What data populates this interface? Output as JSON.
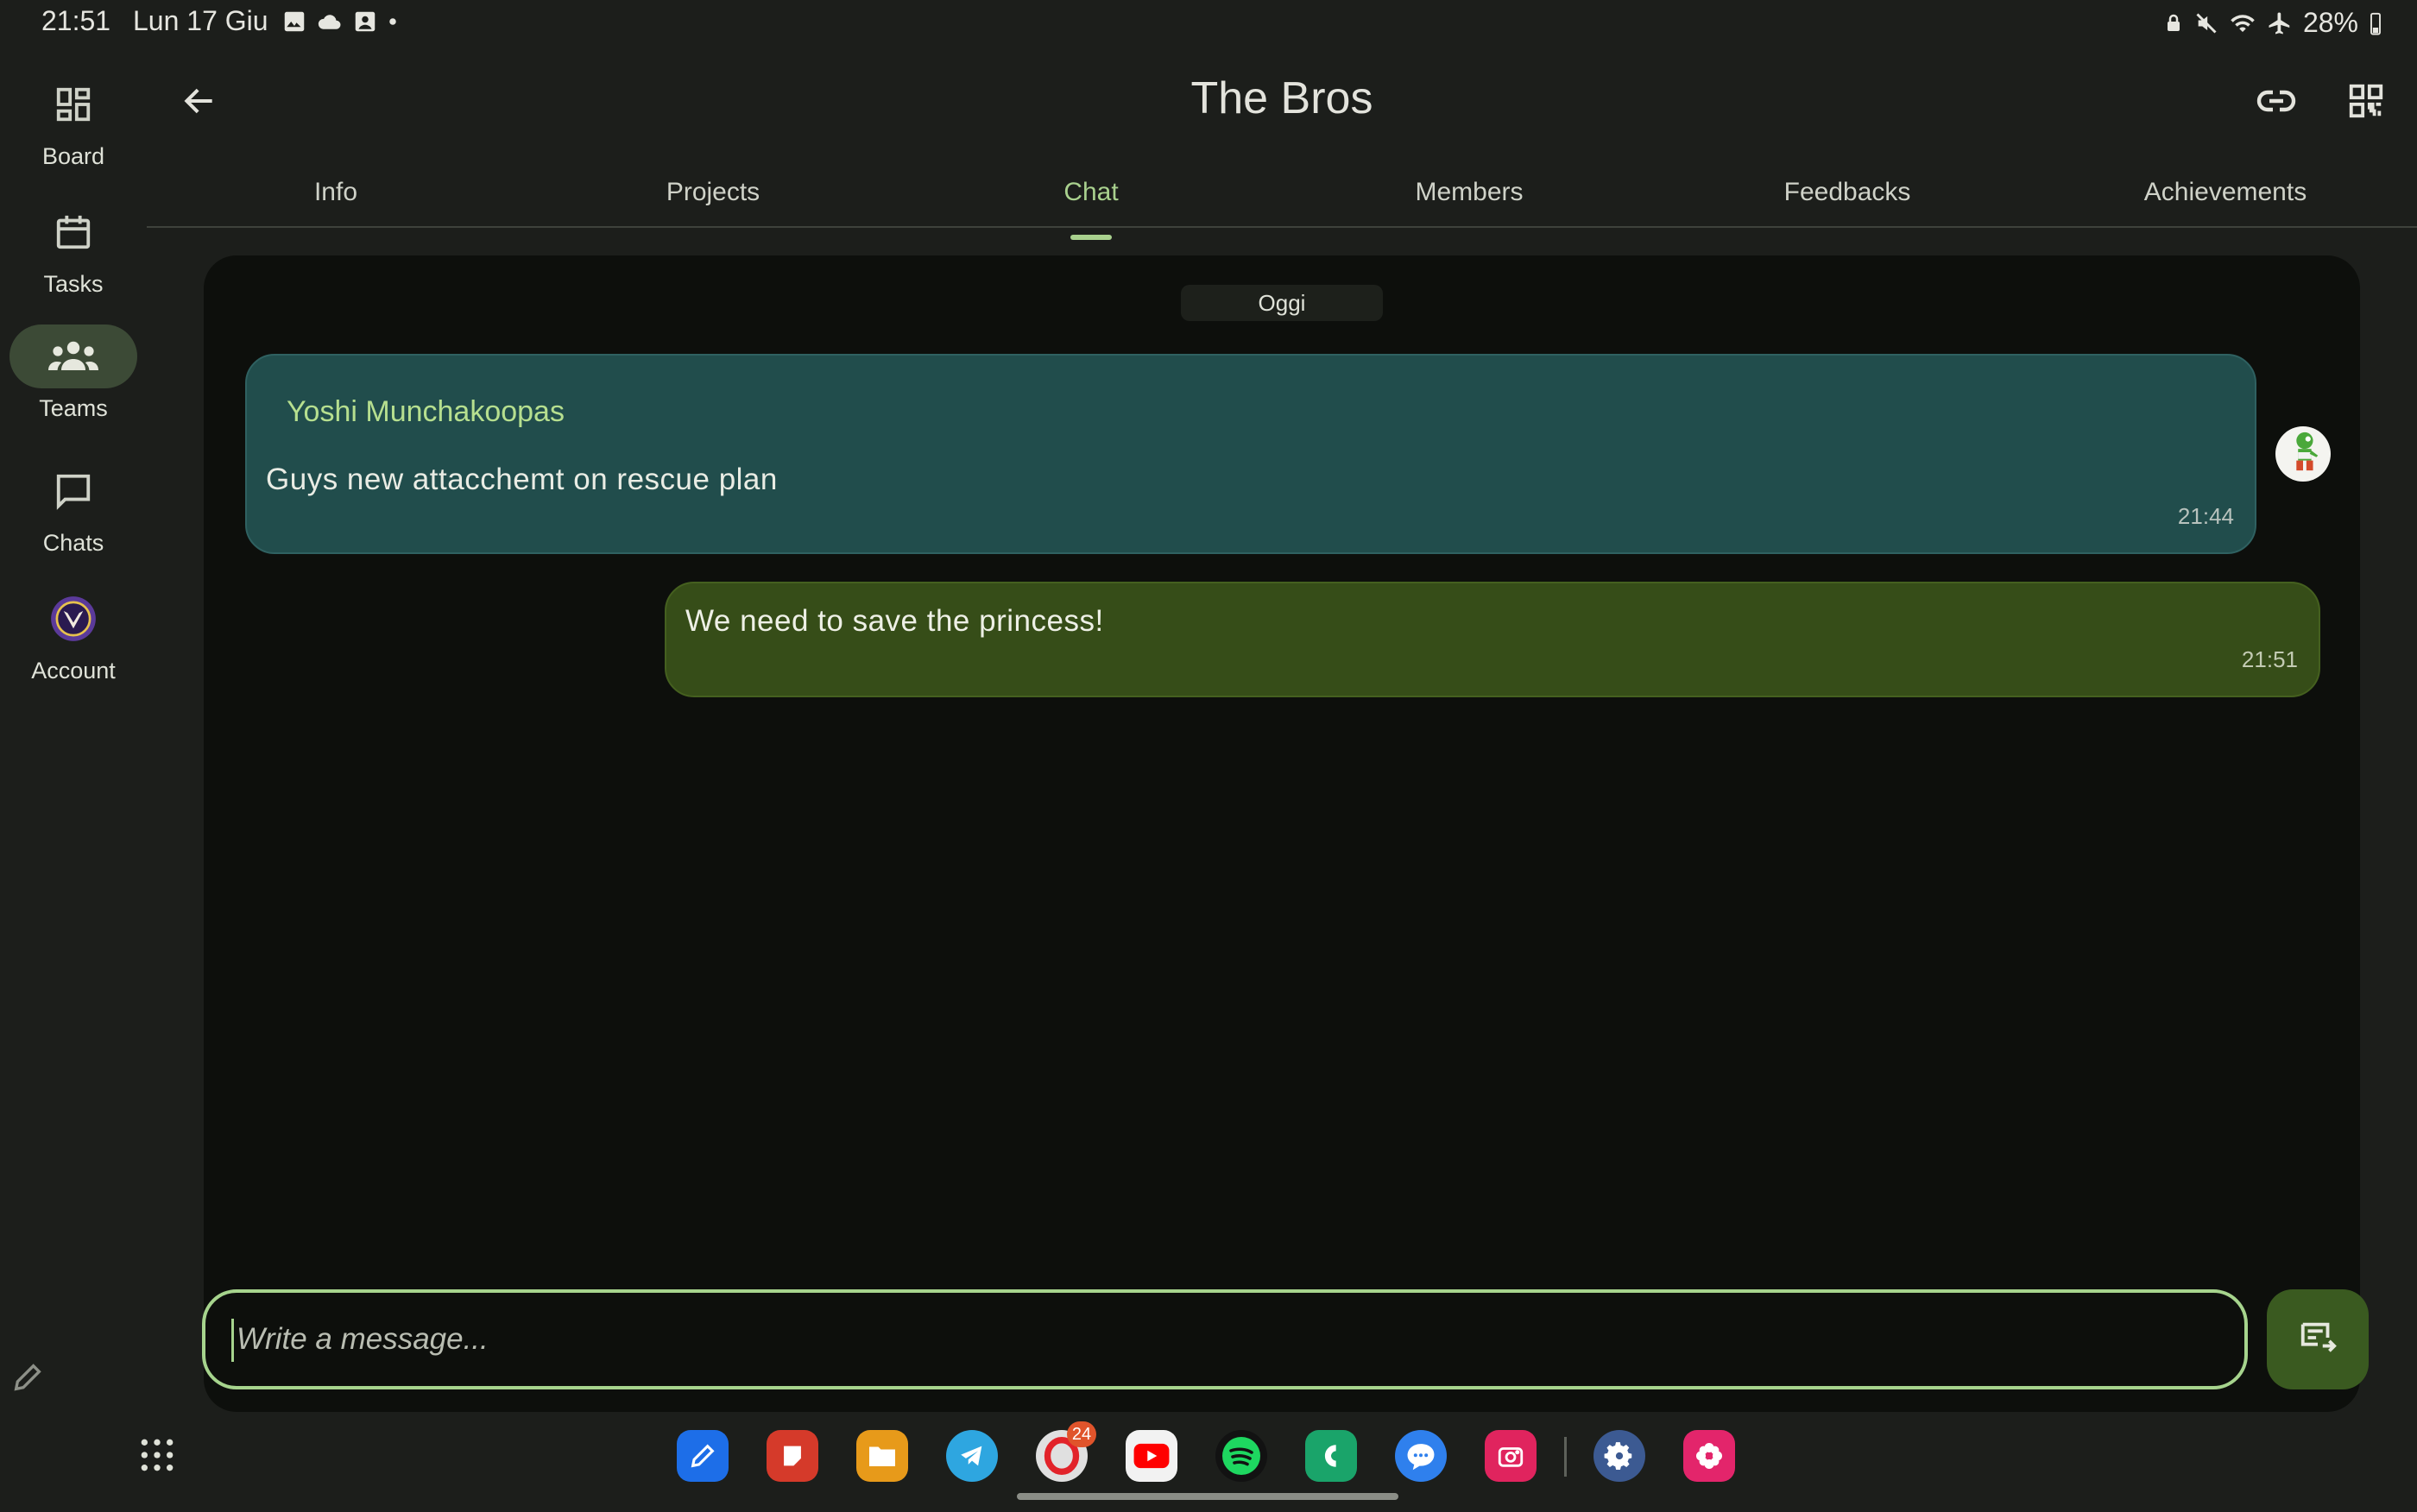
{
  "status_bar": {
    "time": "21:51",
    "date": "Lun 17 Giu",
    "battery": "28%",
    "left_icons": [
      "gallery-icon",
      "cloud-icon",
      "photo-icon",
      "dot-icon"
    ],
    "right_icons": [
      "lock-icon",
      "mute-icon",
      "wifi-icon",
      "airplane-icon"
    ]
  },
  "nav_rail": {
    "items": [
      {
        "label": "Board",
        "icon": "board-icon",
        "active": false
      },
      {
        "label": "Tasks",
        "icon": "calendar-icon",
        "active": false
      },
      {
        "label": "Teams",
        "icon": "teams-icon",
        "active": true
      },
      {
        "label": "Chats",
        "icon": "chat-bubble-icon",
        "active": false
      },
      {
        "label": "Account",
        "icon": "account-avatar",
        "active": false
      }
    ]
  },
  "header": {
    "title": "The Bros"
  },
  "tabs": [
    {
      "label": "Info"
    },
    {
      "label": "Projects"
    },
    {
      "label": "Chat",
      "active": true
    },
    {
      "label": "Members"
    },
    {
      "label": "Feedbacks"
    },
    {
      "label": "Achievements"
    }
  ],
  "chat": {
    "date_separator": "Oggi",
    "messages": [
      {
        "sender": "Yoshi Munchakoopas",
        "text": "Guys new attacchemt on rescue plan",
        "time": "21:44",
        "direction": "incoming"
      },
      {
        "text": "We need to save the princess!",
        "time": "21:51",
        "direction": "outgoing"
      }
    ]
  },
  "composer": {
    "placeholder": "Write a message..."
  },
  "dock": {
    "apps": [
      "pen-app-icon",
      "notes-app-icon",
      "files-app-icon",
      "telegram-app-icon",
      "opera-app-icon",
      "youtube-app-icon",
      "spotify-app-icon",
      "phone-app-icon",
      "messages-app-icon",
      "screen-recorder-app-icon",
      "settings-app-icon",
      "flower-app-icon"
    ],
    "opera_badge": "24"
  },
  "colors": {
    "accent": "#a9d18e",
    "incoming_bubble": "#214d4c",
    "outgoing_bubble": "#364d18",
    "background": "#1c1e1b",
    "panel": "#0d0f0c"
  }
}
